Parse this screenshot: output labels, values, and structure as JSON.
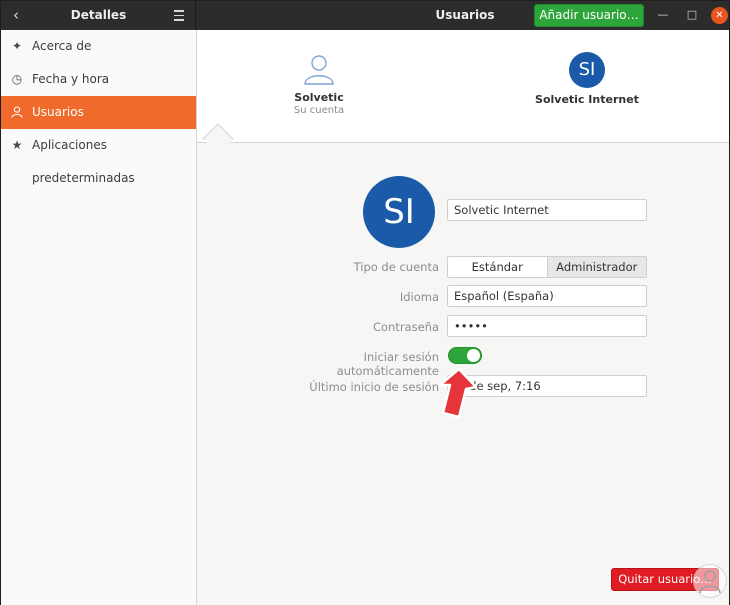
{
  "header": {
    "left_title": "Detalles",
    "main_title": "Usuarios",
    "add_user_label": "Añadir usuario…",
    "back_icon": "chevron-left-icon",
    "menu_icon": "hamburger-menu-icon"
  },
  "sidebar": {
    "items": [
      {
        "label": "Acerca de",
        "icon": "sparkle-icon",
        "glyph": "✦"
      },
      {
        "label": "Fecha y hora",
        "icon": "clock-icon",
        "glyph": "◷"
      },
      {
        "label": "Usuarios",
        "icon": "user-icon",
        "glyph": "♙",
        "active": true
      },
      {
        "label": "Aplicaciones predeterminadas",
        "icon": "star-icon",
        "glyph": "★"
      }
    ]
  },
  "users": [
    {
      "name": "Solvetic",
      "subtitle": "Su cuenta"
    },
    {
      "name": "Solvetic Internet",
      "initials": "SI"
    }
  ],
  "details": {
    "initials": "SI",
    "name_value": "Solvetic Internet",
    "account_type_label": "Tipo de cuenta",
    "account_type_standard": "Estándar",
    "account_type_admin": "Administrador",
    "language_label": "Idioma",
    "language_value": "Español (España)",
    "password_label": "Contraseña",
    "password_value": "•••••",
    "autologin_label": "Iniciar sesión automáticamente",
    "autologin_enabled": true,
    "last_login_label": "Último inicio de sesión",
    "last_login_value": "… de sep,  7:16",
    "remove_user_label": "Quitar usuario…"
  },
  "colors": {
    "accent_orange": "#f06a2c",
    "green": "#2ea53a",
    "avatar_blue": "#1a5aa8",
    "red": "#e01b24"
  }
}
